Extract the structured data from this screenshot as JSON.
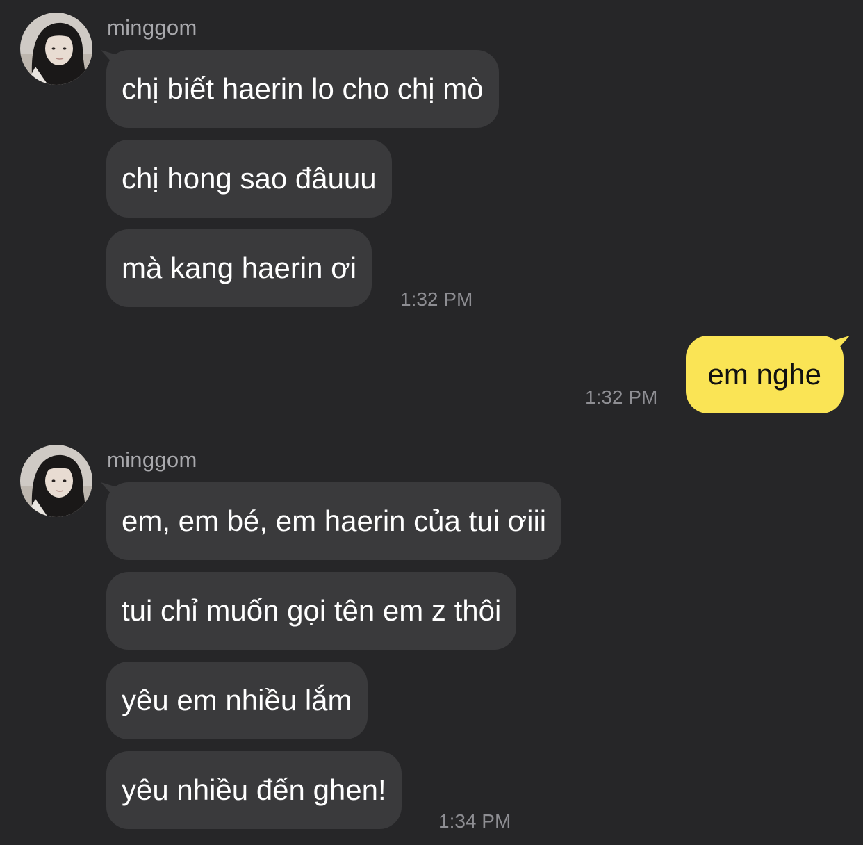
{
  "colors": {
    "background": "#262628",
    "incoming_bubble": "#3a3a3c",
    "outgoing_bubble": "#fae455",
    "incoming_text": "#ffffff",
    "outgoing_text": "#111111",
    "meta_text": "#8e8e93"
  },
  "groups": [
    {
      "sender": "minggom",
      "avatar_icon": "profile-photo",
      "messages": [
        "chị biết haerin lo cho chị mò",
        "chị hong sao đâuuu",
        "mà kang haerin ơi"
      ],
      "time": "1:32 PM"
    },
    {
      "sender": "me",
      "messages": [
        "em nghe"
      ],
      "time": "1:32 PM"
    },
    {
      "sender": "minggom",
      "avatar_icon": "profile-photo",
      "messages": [
        "em, em bé, em haerin của tui ơiii",
        "tui chỉ muốn gọi tên em z thôi",
        "yêu em nhiều lắm",
        "yêu nhiều đến ghen!"
      ],
      "time": "1:34 PM"
    }
  ]
}
